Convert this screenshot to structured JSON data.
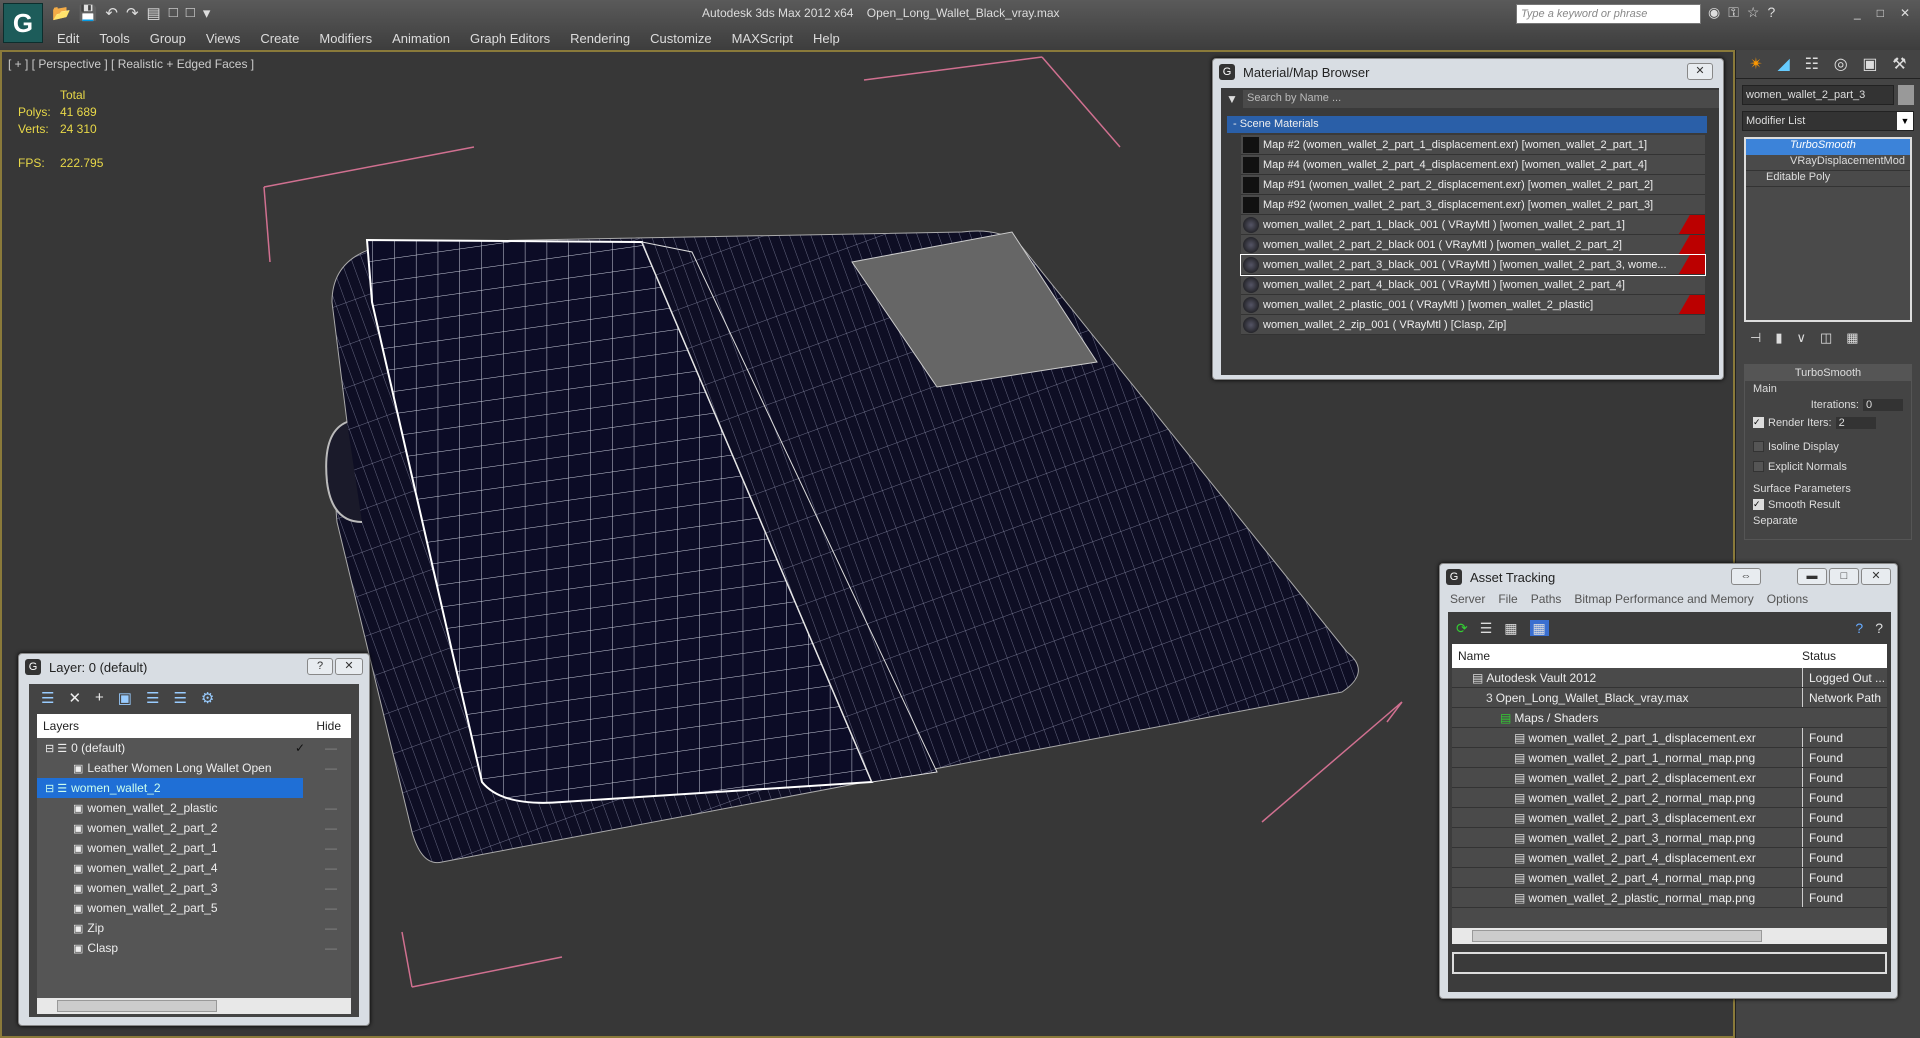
{
  "app": {
    "title": "Autodesk 3ds Max  2012 x64",
    "file": "Open_Long_Wallet_Black_vray.max",
    "search_placeholder": "Type a keyword or phrase"
  },
  "menu": [
    "Edit",
    "Tools",
    "Group",
    "Views",
    "Create",
    "Modifiers",
    "Animation",
    "Graph Editors",
    "Rendering",
    "Customize",
    "MAXScript",
    "Help"
  ],
  "viewport": {
    "label": "[ + ] [ Perspective ] [ Realistic + Edged Faces ]",
    "total": "Total",
    "polys_label": "Polys:",
    "polys": "41 689",
    "verts_label": "Verts:",
    "verts": "24 310",
    "fps_label": "FPS:",
    "fps": "222.795"
  },
  "material_browser": {
    "title": "Material/Map Browser",
    "search_placeholder": "Search by Name ...",
    "group": "- Scene Materials",
    "items": [
      {
        "text": "Map #2 (women_wallet_2_part_1_displacement.exr)  [women_wallet_2_part_1]",
        "red": false
      },
      {
        "text": "Map #4 (women_wallet_2_part_4_displacement.exr)  [women_wallet_2_part_4]",
        "red": false
      },
      {
        "text": "Map #91 (women_wallet_2_part_2_displacement.exr)  [women_wallet_2_part_2]",
        "red": false
      },
      {
        "text": "Map #92 (women_wallet_2_part_3_displacement.exr)  [women_wallet_2_part_3]",
        "red": false
      },
      {
        "text": "women_wallet_2_part_1_black_001  ( VRayMtl )  [women_wallet_2_part_1]",
        "red": true
      },
      {
        "text": "women_wallet_2_part_2_black 001  ( VRayMtl )  [women_wallet_2_part_2]",
        "red": true
      },
      {
        "text": "women_wallet_2_part_3_black_001  ( VRayMtl )  [women_wallet_2_part_3, wome...",
        "red": true
      },
      {
        "text": "women_wallet_2_part_4_black_001  ( VRayMtl )  [women_wallet_2_part_4]",
        "red": false
      },
      {
        "text": "women_wallet_2_plastic_001  ( VRayMtl )  [women_wallet_2_plastic]",
        "red": true
      },
      {
        "text": "women_wallet_2_zip_001  ( VRayMtl )  [Clasp, Zip]",
        "red": false
      }
    ]
  },
  "command_panel": {
    "object_name": "women_wallet_2_part_3",
    "modifier_list": "Modifier List",
    "stack": [
      "TurboSmooth",
      "VRayDisplacementMod",
      "Editable Poly"
    ],
    "rollout": "TurboSmooth",
    "main": "Main",
    "iterations_label": "Iterations:",
    "iterations": "0",
    "render_iters_label": "Render Iters:",
    "render_iters": "2",
    "isoline": "Isoline Display",
    "explicit": "Explicit Normals",
    "surface": "Surface Parameters",
    "smooth_result": "Smooth Result",
    "separate": "Separate"
  },
  "layer_dialog": {
    "title": "Layer: 0 (default)",
    "col_layers": "Layers",
    "col_hide": "Hide",
    "rows": [
      {
        "text": "0 (default)",
        "indent": 0,
        "layer": true
      },
      {
        "text": "Leather Women Long Wallet Open",
        "indent": 1
      },
      {
        "text": "women_wallet_2",
        "indent": 0,
        "layer": true,
        "selected": true
      },
      {
        "text": "women_wallet_2_plastic",
        "indent": 1
      },
      {
        "text": "women_wallet_2_part_2",
        "indent": 1
      },
      {
        "text": "women_wallet_2_part_1",
        "indent": 1
      },
      {
        "text": "women_wallet_2_part_4",
        "indent": 1
      },
      {
        "text": "women_wallet_2_part_3",
        "indent": 1
      },
      {
        "text": "women_wallet_2_part_5",
        "indent": 1
      },
      {
        "text": "Zip",
        "indent": 1
      },
      {
        "text": "Clasp",
        "indent": 1
      }
    ]
  },
  "asset_tracking": {
    "title": "Asset Tracking",
    "menu": [
      "Server",
      "File",
      "Paths",
      "Bitmap Performance and Memory",
      "Options"
    ],
    "col_name": "Name",
    "col_status": "Status",
    "rows": [
      {
        "name": "Autodesk Vault 2012",
        "status": "Logged Out ...",
        "indent": 1
      },
      {
        "name": "Open_Long_Wallet_Black_vray.max",
        "status": "Network Path",
        "indent": 2
      },
      {
        "name": "Maps / Shaders",
        "status": "",
        "indent": 3
      },
      {
        "name": "women_wallet_2_part_1_displacement.exr",
        "status": "Found",
        "indent": 4
      },
      {
        "name": "women_wallet_2_part_1_normal_map.png",
        "status": "Found",
        "indent": 4
      },
      {
        "name": "women_wallet_2_part_2_displacement.exr",
        "status": "Found",
        "indent": 4
      },
      {
        "name": "women_wallet_2_part_2_normal_map.png",
        "status": "Found",
        "indent": 4
      },
      {
        "name": "women_wallet_2_part_3_displacement.exr",
        "status": "Found",
        "indent": 4
      },
      {
        "name": "women_wallet_2_part_3_normal_map.png",
        "status": "Found",
        "indent": 4
      },
      {
        "name": "women_wallet_2_part_4_displacement.exr",
        "status": "Found",
        "indent": 4
      },
      {
        "name": "women_wallet_2_part_4_normal_map.png",
        "status": "Found",
        "indent": 4
      },
      {
        "name": "women_wallet_2_plastic_normal_map.png",
        "status": "Found",
        "indent": 4
      }
    ]
  }
}
